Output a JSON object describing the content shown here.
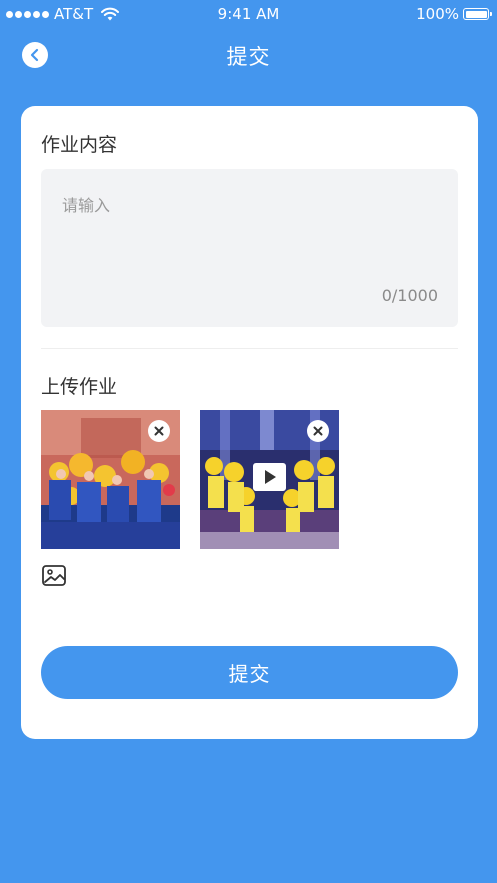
{
  "status_bar": {
    "carrier": "AT&T",
    "time": "9:41 AM",
    "battery": "100%"
  },
  "nav": {
    "title": "提交",
    "back_icon": "chevron-left-icon"
  },
  "form": {
    "content_label": "作业内容",
    "content_placeholder": "请输入",
    "counter": "0/1000",
    "upload_label": "上传作业",
    "attachments": [
      {
        "type": "image",
        "remove_icon": "close-icon"
      },
      {
        "type": "video",
        "remove_icon": "close-icon",
        "overlay_icon": "play-icon"
      }
    ],
    "add_media_icon": "image-icon"
  },
  "submit": {
    "label": "提交"
  },
  "colors": {
    "primary": "#4496ee",
    "card": "#ffffff",
    "input_bg": "#f2f3f5",
    "text": "#333333",
    "placeholder": "#9a9a9a"
  }
}
